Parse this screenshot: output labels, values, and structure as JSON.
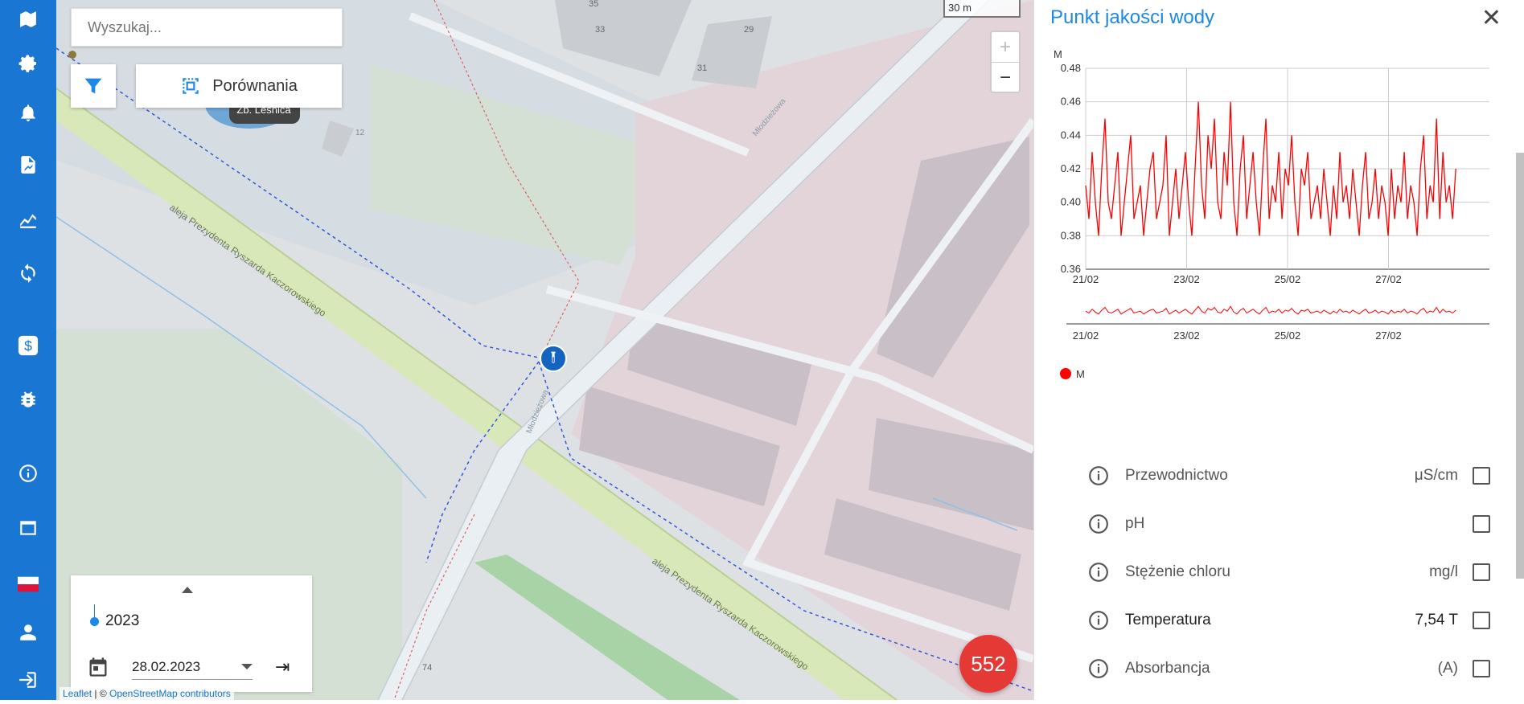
{
  "nav": {
    "items": [
      {
        "icon": "map-icon"
      },
      {
        "icon": "gear-icon"
      },
      {
        "icon": "bell-icon"
      },
      {
        "icon": "report-icon"
      },
      {
        "icon": "chart-icon"
      },
      {
        "icon": "sync-icon"
      },
      {
        "icon": "dollar-icon"
      },
      {
        "icon": "bug-icon"
      },
      {
        "icon": "info-icon"
      },
      {
        "icon": "window-icon"
      },
      {
        "icon": "poland-flag-icon"
      },
      {
        "icon": "user-icon"
      },
      {
        "icon": "logout-icon"
      }
    ]
  },
  "map": {
    "search_placeholder": "Wyszukaj...",
    "compare_label": "Porównania",
    "scale_label": "30 m",
    "zoom_in": "+",
    "zoom_out": "−",
    "street_labels": [
      "aleja Prezydenta Ryszarda Kaczorowskiego",
      "aleja Prezydenta Ryszarda Kaczorowskiego",
      "Młodzieżowa",
      "Młodzieżowa"
    ],
    "place_label": "Zb. Leśnica",
    "building_numbers": [
      "35",
      "33",
      "29",
      "31",
      "12",
      "74"
    ],
    "alert_count": "552",
    "attribution_leaflet": "Leaflet",
    "attribution_sep": " | © ",
    "attribution_osm": "OpenStreetMap contributors"
  },
  "timeline": {
    "year": "2023",
    "date": "28.02.2023"
  },
  "panel": {
    "title": "Punkt jakości wody",
    "close": "✕",
    "legend_label": "M",
    "params": [
      {
        "name": "Przewodnictwo",
        "value": "μS/cm",
        "active": false
      },
      {
        "name": "pH",
        "value": "",
        "active": false
      },
      {
        "name": "Stężenie chloru",
        "value": "mg/l",
        "active": false
      },
      {
        "name": "Temperatura",
        "value": "7,54 T",
        "active": true
      },
      {
        "name": "Absorbancja",
        "value": "(A)",
        "active": false
      }
    ]
  },
  "colors": {
    "nav_bg": "#1976d2",
    "accent": "#1e88e5",
    "series": "#ff0000",
    "fab": "#e53935"
  },
  "chart_data": {
    "type": "line",
    "title": "",
    "ylabel": "M",
    "xlabel": "",
    "ylim": [
      0.36,
      0.48
    ],
    "yticks": [
      "0.36",
      "0.38",
      "0.40",
      "0.42",
      "0.44",
      "0.46",
      "0.48"
    ],
    "xticks": [
      "21/02",
      "23/02",
      "25/02",
      "27/02"
    ],
    "xrange": [
      "2023-02-21",
      "2023-02-29"
    ],
    "legend": "bottom-left",
    "grid": true,
    "series": [
      {
        "name": "M",
        "color": "#ff0000",
        "x_start": "2023-02-21",
        "x_end": "2023-02-28 08:00",
        "values": [
          0.41,
          0.39,
          0.43,
          0.4,
          0.38,
          0.42,
          0.45,
          0.4,
          0.39,
          0.41,
          0.43,
          0.38,
          0.4,
          0.42,
          0.44,
          0.39,
          0.4,
          0.41,
          0.38,
          0.4,
          0.42,
          0.43,
          0.39,
          0.4,
          0.41,
          0.44,
          0.38,
          0.4,
          0.42,
          0.39,
          0.41,
          0.43,
          0.4,
          0.38,
          0.42,
          0.46,
          0.41,
          0.39,
          0.44,
          0.42,
          0.45,
          0.4,
          0.39,
          0.43,
          0.41,
          0.46,
          0.4,
          0.38,
          0.42,
          0.44,
          0.39,
          0.41,
          0.43,
          0.4,
          0.38,
          0.42,
          0.45,
          0.39,
          0.41,
          0.4,
          0.43,
          0.39,
          0.42,
          0.41,
          0.44,
          0.4,
          0.38,
          0.42,
          0.41,
          0.43,
          0.39,
          0.4,
          0.41,
          0.39,
          0.42,
          0.4,
          0.38,
          0.41,
          0.39,
          0.43,
          0.4,
          0.41,
          0.39,
          0.42,
          0.4,
          0.38,
          0.41,
          0.43,
          0.39,
          0.4,
          0.42,
          0.39,
          0.41,
          0.4,
          0.38,
          0.42,
          0.39,
          0.41,
          0.4,
          0.43,
          0.39,
          0.41,
          0.4,
          0.38,
          0.42,
          0.44,
          0.39,
          0.41,
          0.4,
          0.45,
          0.39,
          0.43,
          0.4,
          0.41,
          0.39,
          0.42
        ]
      }
    ]
  }
}
